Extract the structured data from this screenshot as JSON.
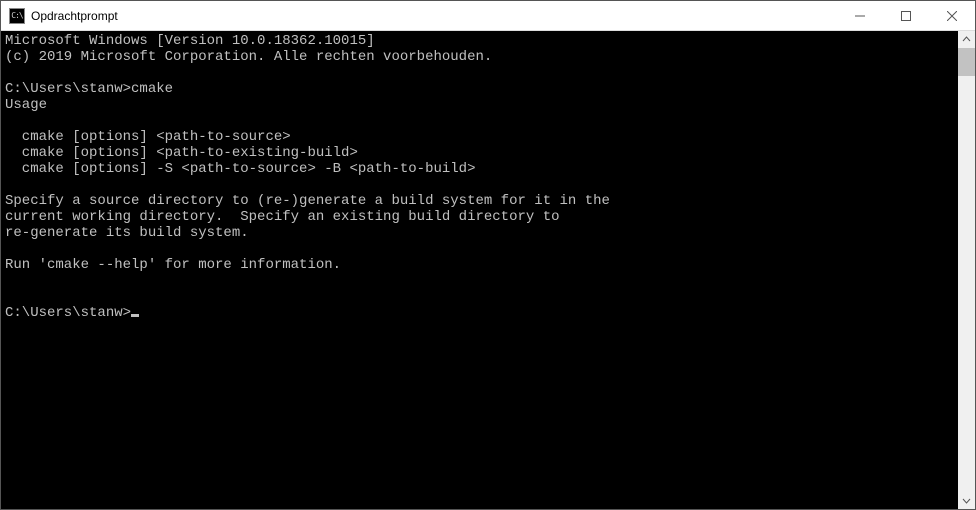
{
  "window": {
    "title": "Opdrachtprompt"
  },
  "terminal": {
    "lines": [
      "Microsoft Windows [Version 10.0.18362.10015]",
      "(c) 2019 Microsoft Corporation. Alle rechten voorbehouden.",
      "",
      "C:\\Users\\stanw>cmake",
      "Usage",
      "",
      "  cmake [options] <path-to-source>",
      "  cmake [options] <path-to-existing-build>",
      "  cmake [options] -S <path-to-source> -B <path-to-build>",
      "",
      "Specify a source directory to (re-)generate a build system for it in the",
      "current working directory.  Specify an existing build directory to",
      "re-generate its build system.",
      "",
      "Run 'cmake --help' for more information.",
      "",
      "",
      "C:\\Users\\stanw>"
    ]
  }
}
